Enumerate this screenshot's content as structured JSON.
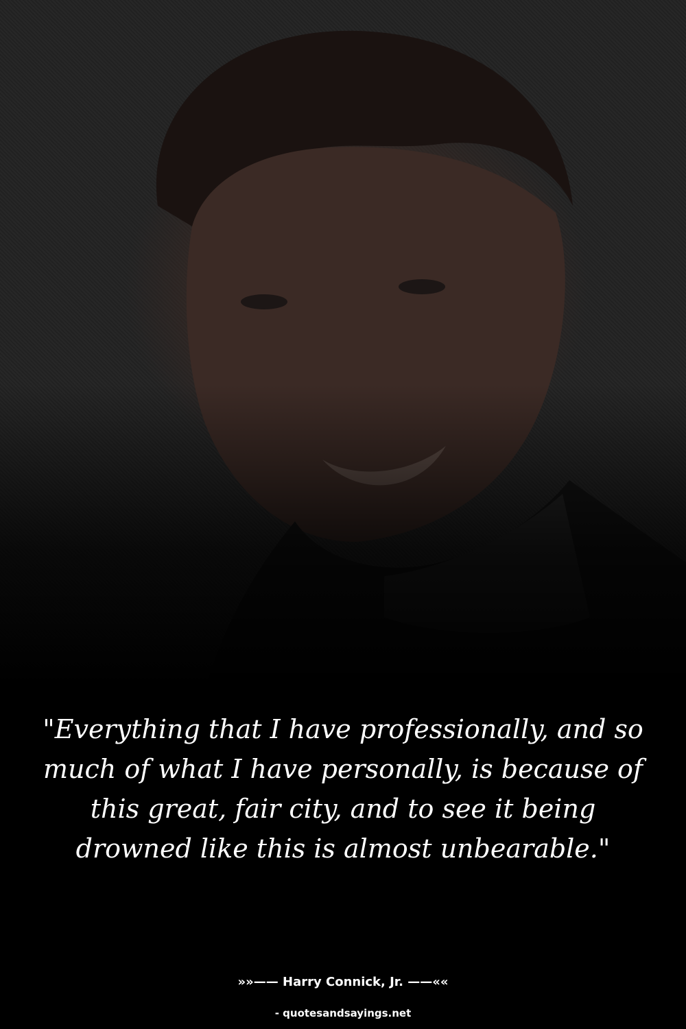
{
  "quote": {
    "text": "\"Everything that I have professionally, and so much of what I have personally, is because of this great, fair city, and to see it being drowned like this is almost unbearable.\""
  },
  "author": {
    "line": "»»—— Harry Connick, Jr. ——««"
  },
  "source": {
    "text": "- quotesandsayings.net"
  },
  "colors": {
    "background": "#000000",
    "text": "#ffffff"
  }
}
